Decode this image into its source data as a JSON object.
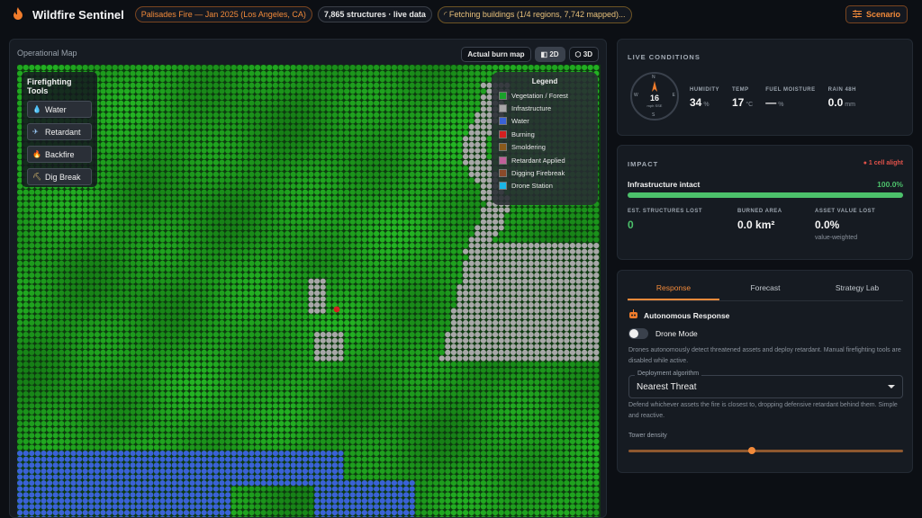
{
  "header": {
    "title": "Wildfire Sentinel",
    "fire_pill": "Palisades Fire — Jan 2025 (Los Angeles, CA)",
    "structures_pill": "7,865 structures · live data",
    "fetch_pill": "Fetching buildings (1/4 regions, 7,742 mapped)...",
    "scenario_button": "Scenario"
  },
  "map": {
    "title": "Operational Map",
    "burn_button": "Actual burn map",
    "btn_2d": "2D",
    "btn_3d": "3D",
    "tools_title": "Firefighting Tools",
    "tools": [
      {
        "label": "Water",
        "icon": "water-drop-icon"
      },
      {
        "label": "Retardant",
        "icon": "plane-icon"
      },
      {
        "label": "Backfire",
        "icon": "flame-icon"
      },
      {
        "label": "Dig Break",
        "icon": "shovel-icon"
      }
    ],
    "legend_title": "Legend",
    "legend": [
      {
        "label": "Vegetation / Forest",
        "color": "#1aa12a"
      },
      {
        "label": "Infrastructure",
        "color": "#a8a8a8"
      },
      {
        "label": "Water",
        "color": "#3a62d6"
      },
      {
        "label": "Burning",
        "color": "#d42020"
      },
      {
        "label": "Smoldering",
        "color": "#8a5a1c"
      },
      {
        "label": "Retardant Applied",
        "color": "#c0609a"
      },
      {
        "label": "Digging Firebreak",
        "color": "#8a4a2a"
      },
      {
        "label": "Drone Station",
        "color": "#1ab6e6"
      }
    ]
  },
  "live": {
    "title": "LIVE CONDITIONS",
    "compass": {
      "n": "N",
      "e": "E",
      "s": "S",
      "w": "W",
      "speed": "16",
      "unit": "mph SSE"
    },
    "metrics": [
      {
        "label": "HUMIDITY",
        "value": "34",
        "unit": "%"
      },
      {
        "label": "TEMP",
        "value": "17",
        "unit": "°C"
      },
      {
        "label": "FUEL MOISTURE",
        "value": "—",
        "unit": "%"
      },
      {
        "label": "RAIN 48H",
        "value": "0.0",
        "unit": "mm"
      }
    ]
  },
  "impact": {
    "title": "IMPACT",
    "alert": "● 1 cell alight",
    "intact_label": "Infrastructure intact",
    "intact_pct": "100.0%",
    "intact_fraction": 1.0,
    "stats": [
      {
        "label": "EST. STRUCTURES LOST",
        "value": "0",
        "sub": ""
      },
      {
        "label": "BURNED AREA",
        "value": "0.0 km²",
        "sub": ""
      },
      {
        "label": "ASSET VALUE LOST",
        "value": "0.0%",
        "sub": "value-weighted"
      }
    ]
  },
  "response": {
    "tabs": [
      "Response",
      "Forecast",
      "Strategy Lab"
    ],
    "section_title": "Autonomous Response",
    "drone_label": "Drone Mode",
    "drone_desc": "Drones autonomously detect threatened assets and deploy retardant. Manual firefighting tools are disabled while active.",
    "algo_label": "Deployment algorithm",
    "algo_value": "Nearest Threat",
    "algo_desc": "Defend whichever assets the fire is closest to, dropping defensive retardant behind them. Simple and reactive.",
    "slider_label": "Tower density",
    "slider_fraction": 0.45
  }
}
